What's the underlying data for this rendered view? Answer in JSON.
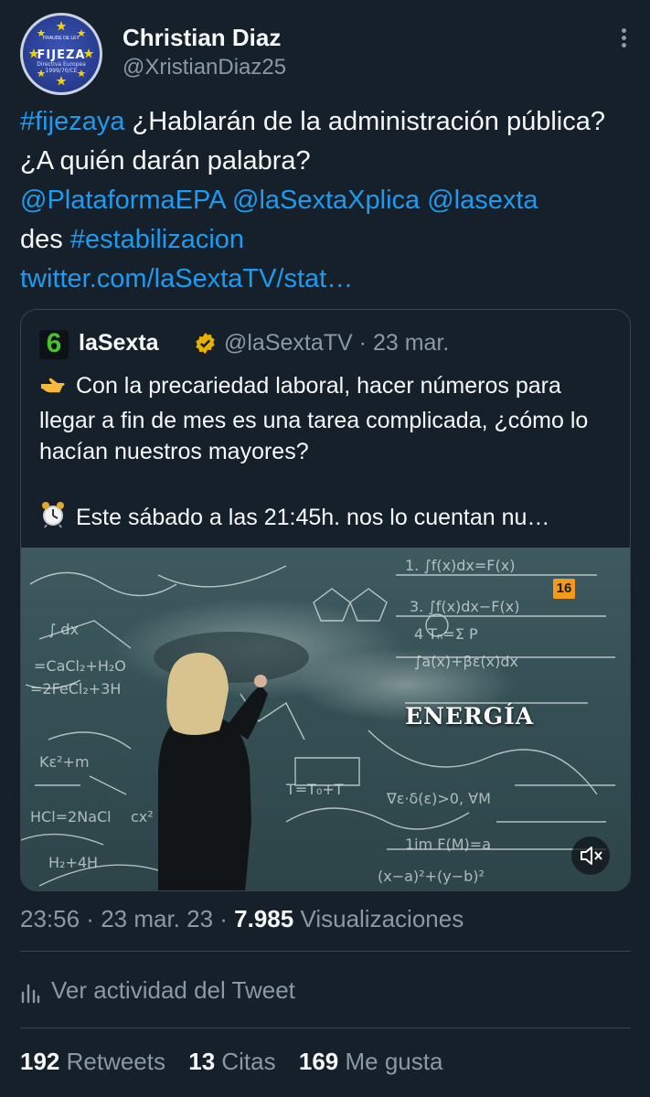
{
  "author": {
    "name": "Christian Diaz",
    "handle": "@XristianDiaz25",
    "avatar": {
      "brand": "FIJEZA",
      "caption_top": "FRAUDE DE LEY",
      "caption_bottom": "Directiva Europea 1999/70/CE"
    }
  },
  "tweet": {
    "hashtag1": "#fijezaya",
    "text1": " ¿Hablarán de la administración pública? ¿A quién darán palabra?",
    "mention1": "@PlataformaEPA",
    "mention2": "@laSextaXplica",
    "mention3": "@lasexta",
    "text2": "des ",
    "hashtag2": "#estabilizacion",
    "url": "twitter.com/laSextaTV/stat…"
  },
  "quoted": {
    "logo_glyph": "6",
    "name": "laSexta",
    "handle": "@laSextaTV",
    "separator": " · ",
    "date": "23 mar.",
    "line1": "Con la precariedad laboral, hacer números para llegar a fin de mes es una tarea complicada, ¿cómo lo hacían nuestros mayores?",
    "line2": "Este sábado a las 21:45h. nos lo cuentan nu…",
    "media": {
      "rating": "16",
      "overlay_text": "ENERGÍA"
    }
  },
  "meta": {
    "time": "23:56",
    "sep": " · ",
    "date": "23 mar. 23",
    "views_count": "7.985",
    "views_label": " Visualizaciones"
  },
  "activity": {
    "label": "Ver actividad del Tweet"
  },
  "stats": {
    "retweets_count": "192",
    "retweets_label": " Retweets",
    "quotes_count": "13",
    "quotes_label": " Citas",
    "likes_count": "169",
    "likes_label": " Me gusta"
  },
  "colors": {
    "background": "#15202b",
    "link": "#1d9bf0",
    "secondary_text": "#8b98a5",
    "verified_badge": "#e8b100"
  }
}
